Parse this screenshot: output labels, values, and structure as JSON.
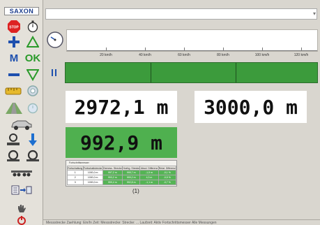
{
  "app": {
    "logo": "SAXON"
  },
  "toolbar": {
    "m_label": "M",
    "ok_label": "OK",
    "stop_label": "STOP"
  },
  "speed_scale": {
    "labels": [
      "20 km/h",
      "40 km/h",
      "60 km/h",
      "80 km/h",
      "100 km/h",
      "120 km/h"
    ]
  },
  "readouts": {
    "actual": "2972,1 m",
    "target": "3000,0 m",
    "remaining": "992,9 m"
  },
  "table": {
    "title": "Fortschrittsmesser",
    "headers": [
      "Fortschaltung",
      "Fortschaltstrecke",
      "Gemess. Strecke",
      "Hoehg. Strecke",
      "Absol. Differenz",
      "Relat. Differenz"
    ],
    "rows": [
      [
        "1",
        "1000,0 m",
        "997,2 m",
        "995,7 m",
        "-1,5 m",
        "-0,1 %"
      ],
      [
        "2",
        "1000,0 m",
        "993,2 m",
        "999,2 m",
        "4,3 m",
        "-0,5 %"
      ],
      [
        "3",
        "1000,0 m",
        "999,4 m",
        "992,8 m",
        "-1,1 m",
        "-0,7 %"
      ]
    ]
  },
  "caption": "(1)",
  "status": {
    "text": "Messstrecke Zaehlung: Ein/In Zeit: Messstrecke: Strecke: ... Laufzeit: Aktiv  Fortschrittsmesser Alle Messungen"
  },
  "colors": {
    "accent_green": "#3c9b3c",
    "readout_green": "#4fb04f",
    "brand_blue": "#1c3d8c"
  }
}
